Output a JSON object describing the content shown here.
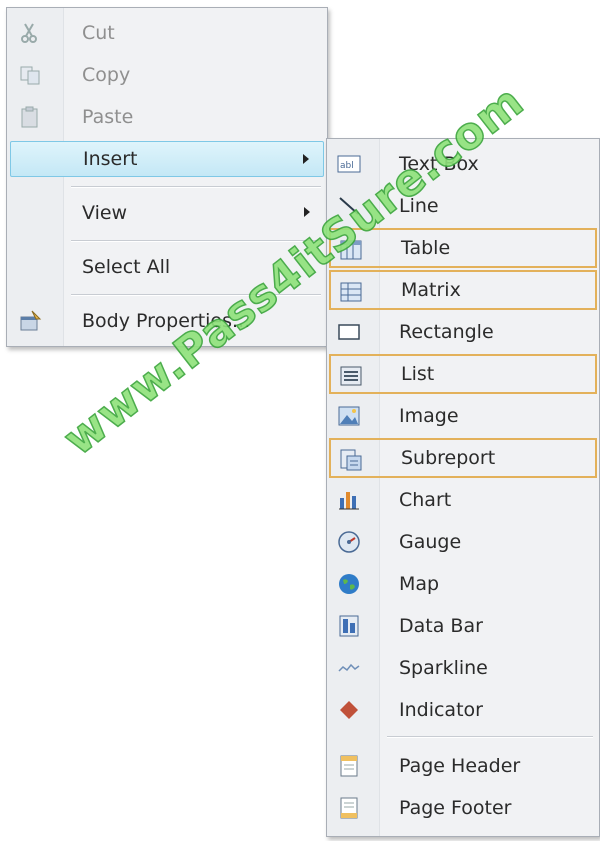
{
  "context_menu": {
    "items": [
      {
        "label": "Cut",
        "icon": "scissors-icon",
        "enabled": false
      },
      {
        "label": "Copy",
        "icon": "copy-icon",
        "enabled": false
      },
      {
        "label": "Paste",
        "icon": "paste-icon",
        "enabled": false
      },
      {
        "label": "Insert",
        "icon": "",
        "enabled": true,
        "submenu": true,
        "highlighted": true
      },
      {
        "label": "View",
        "icon": "",
        "enabled": true,
        "submenu": true
      },
      {
        "label": "Select All",
        "icon": "",
        "enabled": true
      },
      {
        "label": "Body Properties...",
        "icon": "properties-icon",
        "enabled": true
      }
    ]
  },
  "insert_submenu": {
    "items": [
      {
        "label": "Text Box",
        "icon": "textbox-icon"
      },
      {
        "label": "Line",
        "icon": "line-icon"
      },
      {
        "label": "Table",
        "icon": "table-icon",
        "boxed": true
      },
      {
        "label": "Matrix",
        "icon": "matrix-icon",
        "boxed": true
      },
      {
        "label": "Rectangle",
        "icon": "rectangle-icon"
      },
      {
        "label": "List",
        "icon": "list-icon",
        "boxed": true
      },
      {
        "label": "Image",
        "icon": "image-icon"
      },
      {
        "label": "Subreport",
        "icon": "subreport-icon",
        "boxed": true
      },
      {
        "label": "Chart",
        "icon": "chart-icon"
      },
      {
        "label": "Gauge",
        "icon": "gauge-icon"
      },
      {
        "label": "Map",
        "icon": "map-icon"
      },
      {
        "label": "Data Bar",
        "icon": "databar-icon"
      },
      {
        "label": "Sparkline",
        "icon": "sparkline-icon"
      },
      {
        "label": "Indicator",
        "icon": "indicator-icon"
      },
      {
        "label": "Page Header",
        "icon": "page-header-icon"
      },
      {
        "label": "Page Footer",
        "icon": "page-footer-icon"
      }
    ]
  },
  "colors": {
    "highlight_border": "#7fc8e6",
    "annotation_box": "#e3b15a",
    "watermark": "#8ee27a"
  },
  "watermark": {
    "text": "www.Pass4itSure.com"
  }
}
